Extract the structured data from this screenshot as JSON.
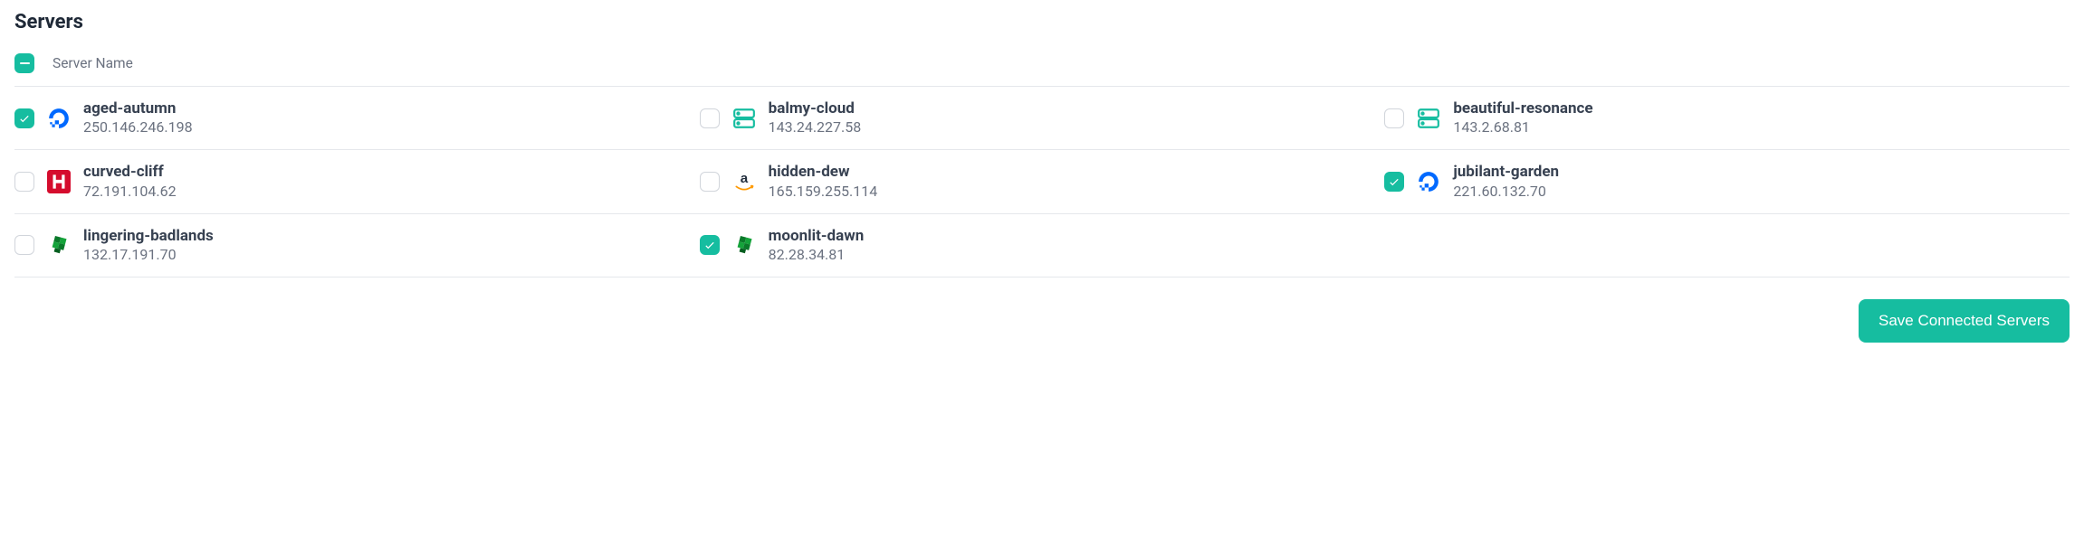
{
  "title": "Servers",
  "header": {
    "column_label": "Server Name"
  },
  "servers": [
    {
      "name": "aged-autumn",
      "ip": "250.146.246.198",
      "checked": true,
      "provider": "digitalocean"
    },
    {
      "name": "balmy-cloud",
      "ip": "143.24.227.58",
      "checked": false,
      "provider": "generic"
    },
    {
      "name": "beautiful-resonance",
      "ip": "143.2.68.81",
      "checked": false,
      "provider": "generic"
    },
    {
      "name": "curved-cliff",
      "ip": "72.191.104.62",
      "checked": false,
      "provider": "hetzner"
    },
    {
      "name": "hidden-dew",
      "ip": "165.159.255.114",
      "checked": false,
      "provider": "aws"
    },
    {
      "name": "jubilant-garden",
      "ip": "221.60.132.70",
      "checked": true,
      "provider": "digitalocean"
    },
    {
      "name": "lingering-badlands",
      "ip": "132.17.191.70",
      "checked": false,
      "provider": "custom"
    },
    {
      "name": "moonlit-dawn",
      "ip": "82.28.34.81",
      "checked": true,
      "provider": "custom"
    }
  ],
  "footer": {
    "save_label": "Save Connected Servers"
  },
  "colors": {
    "accent": "#16bda0"
  }
}
